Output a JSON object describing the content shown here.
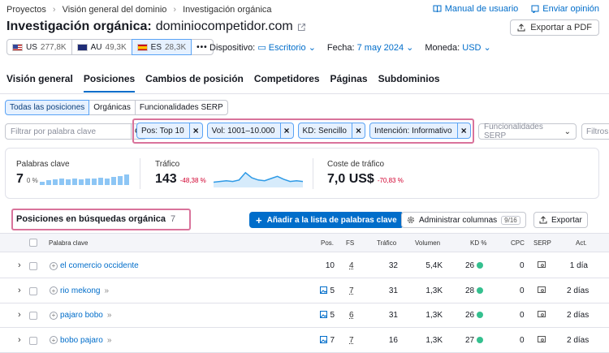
{
  "breadcrumb": [
    "Proyectos",
    "Visión general del dominio",
    "Investigación orgánica"
  ],
  "top_links": {
    "manual": "Manual de usuario",
    "feedback": "Enviar opinión"
  },
  "title": {
    "label": "Investigación orgánica:",
    "domain": "dominiocompetidor.com"
  },
  "export_pdf": "Exportar a PDF",
  "databases": [
    {
      "code": "US",
      "count": "277,8K",
      "flag": "us"
    },
    {
      "code": "AU",
      "count": "49,3K",
      "flag": "au"
    },
    {
      "code": "ES",
      "count": "28,3K",
      "flag": "es",
      "selected": true
    }
  ],
  "more_label": "•••",
  "selectors": {
    "device_label": "Dispositivo:",
    "device_value": "Escritorio",
    "date_label": "Fecha:",
    "date_value": "7 may 2024",
    "currency_label": "Moneda:",
    "currency_value": "USD"
  },
  "tabs": [
    "Visión general",
    "Posiciones",
    "Cambios de posición",
    "Competidores",
    "Páginas",
    "Subdominios"
  ],
  "subtabs": [
    "Todas las posiciones",
    "Orgánicas",
    "Funcionalidades SERP"
  ],
  "filter_placeholder": "Filtrar por palabra clave",
  "chips": [
    "Pos: Top 10",
    "Vol: 1001–10.000",
    "KD: Sencillo",
    "Intención: Informativo"
  ],
  "serp_features_placeholder": "Funcionalidades SERP",
  "more_filters": "Filtros",
  "metrics": {
    "keywords": {
      "label": "Palabras clave",
      "value": "7",
      "change": "0 %",
      "bars": [
        0.3,
        0.4,
        0.5,
        0.55,
        0.5,
        0.6,
        0.5,
        0.55,
        0.6,
        0.65,
        0.6,
        0.7,
        0.8,
        0.9
      ]
    },
    "traffic": {
      "label": "Tráfico",
      "value": "143",
      "change": "-48,38 %",
      "sparkline": [
        0.25,
        0.3,
        0.35,
        0.3,
        0.4,
        0.9,
        0.55,
        0.4,
        0.35,
        0.5,
        0.65,
        0.45,
        0.3,
        0.35,
        0.3
      ]
    },
    "cost": {
      "label": "Coste de tráfico",
      "value": "7,0 US$",
      "change": "-70,83 %"
    }
  },
  "section": {
    "title": "Posiciones en búsquedas orgánica",
    "count": "7"
  },
  "buttons": {
    "add": "Añadir a la lista de palabras clave",
    "columns": "Administrar columnas",
    "columns_badge": "9/16",
    "export": "Exportar"
  },
  "columns": [
    "Palabra clave",
    "Pos.",
    "FS",
    "Tráfico",
    "Volumen",
    "KD %",
    "CPC",
    "SERP",
    "Act."
  ],
  "rows": [
    {
      "keyword": "el comercio occidente",
      "pos": "10",
      "fs": "4",
      "traffic": "32",
      "volume": "5,4K",
      "kd": "26",
      "cpc": "0",
      "updated": "1 día",
      "image_icon": false
    },
    {
      "keyword": "rio mekong",
      "pos": "5",
      "fs": "7",
      "traffic": "31",
      "volume": "1,3K",
      "kd": "28",
      "cpc": "0",
      "updated": "2 días",
      "image_icon": true
    },
    {
      "keyword": "pajaro bobo",
      "pos": "5",
      "fs": "6",
      "traffic": "31",
      "volume": "1,3K",
      "kd": "26",
      "cpc": "0",
      "updated": "2 días",
      "image_icon": true
    },
    {
      "keyword": "bobo pajaro",
      "pos": "7",
      "fs": "7",
      "traffic": "16",
      "volume": "1,3K",
      "kd": "27",
      "cpc": "0",
      "updated": "2 días",
      "image_icon": true
    }
  ],
  "colors": {
    "accent": "#006dca",
    "highlight": "#d9739b",
    "kd_easy": "#35c08f",
    "negative": "#d1002f"
  }
}
